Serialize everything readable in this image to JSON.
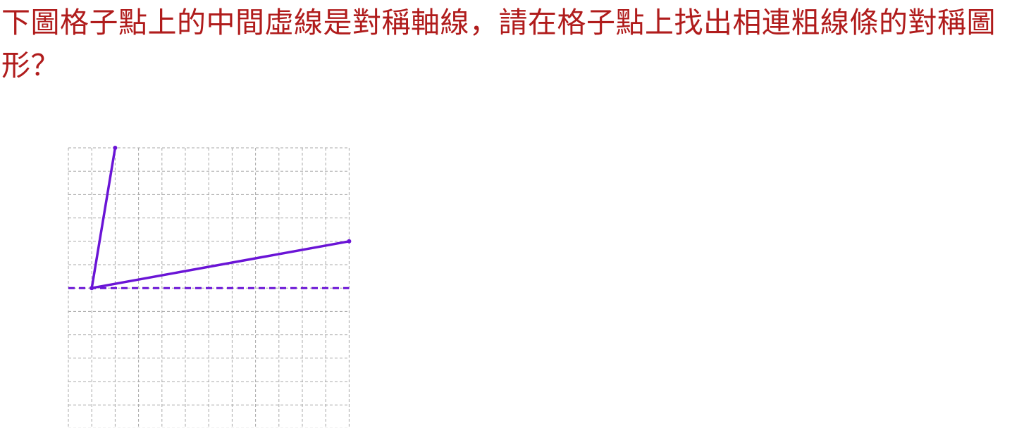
{
  "question": {
    "text": "下圖格子點上的中間虛線是對稱軸線，請在格子點上找出相連粗線條的對稱圖形？"
  },
  "colors": {
    "question_text": "#b01c1c",
    "grid_line": "#a8a8a8",
    "figure_line": "#6a14d6",
    "axis_line": "#6a14d6",
    "background": "#ffffff"
  },
  "grid": {
    "columns": 12,
    "rows": 12
  },
  "axis": {
    "style": "dashed",
    "row": 6
  },
  "figure": {
    "polyline_points": [
      {
        "col": 2,
        "row": 0
      },
      {
        "col": 1,
        "row": 6
      },
      {
        "col": 12,
        "row": 4
      }
    ]
  }
}
